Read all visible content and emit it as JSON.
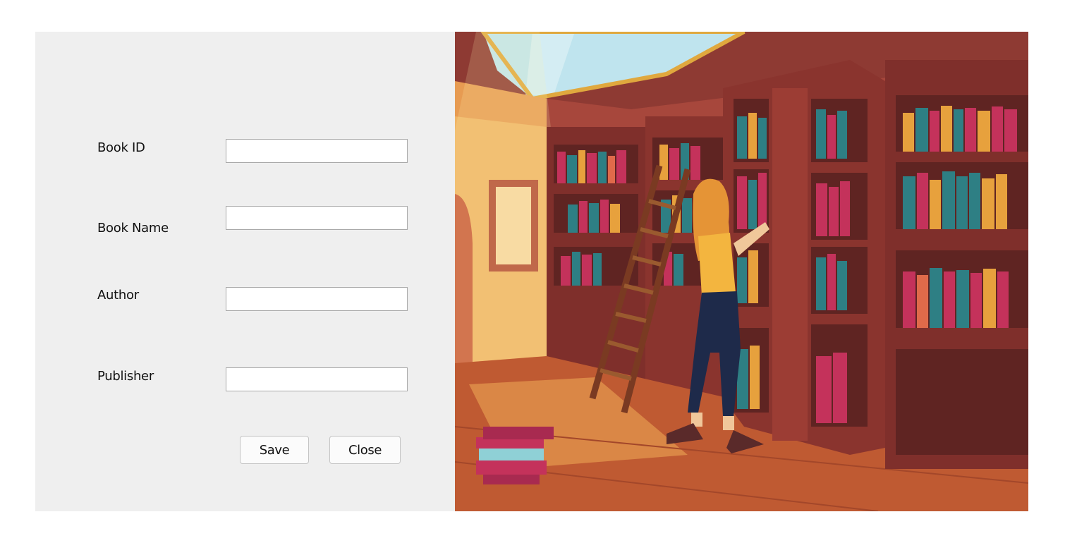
{
  "form": {
    "fields": [
      {
        "label": "Book ID",
        "value": "",
        "placeholder": ""
      },
      {
        "label": "Book Name",
        "value": "",
        "placeholder": ""
      },
      {
        "label": "Author",
        "value": "",
        "placeholder": ""
      },
      {
        "label": "Publisher",
        "value": "",
        "placeholder": ""
      }
    ],
    "save_label": "Save",
    "close_label": "Close"
  },
  "illustration": {
    "subject": "library-with-woman-on-ladder",
    "colors": {
      "wall": "#a7473c",
      "wood": "#7f2f2b",
      "floor": "#bf5a32",
      "sky": "#bfe4ee",
      "teal": "#2e7f84",
      "pink": "#c4325b",
      "gold": "#e7a13d"
    }
  }
}
